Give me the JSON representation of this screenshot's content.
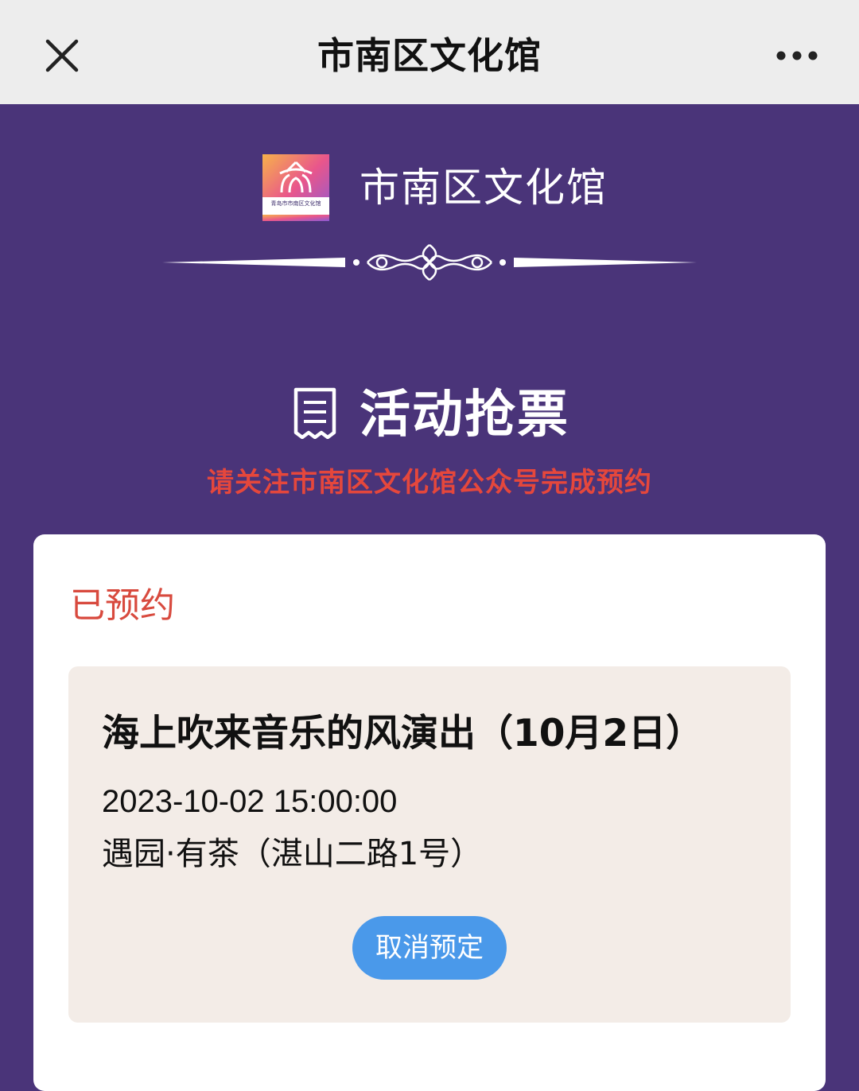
{
  "topbar": {
    "title": "市南区文化馆"
  },
  "brand": {
    "name": "市南区文化馆",
    "logo_text": "青岛市市南区文化馆"
  },
  "section": {
    "title": "活动抢票",
    "notice": "请关注市南区文化馆公众号完成预约"
  },
  "booking": {
    "status": "已预约",
    "event_title": "海上吹来音乐的风演出（10月2日）",
    "datetime": "2023-10-02 15:00:00",
    "location": "遇园·有茶（湛山二路1号）",
    "cancel_label": "取消预定"
  },
  "icons": {
    "close": "close-icon",
    "more": "more-icon",
    "ticket": "ticket-icon",
    "logo": "museum-logo-icon"
  },
  "colors": {
    "background": "#4a3479",
    "topbar": "#ededed",
    "notice": "#e5473c",
    "status": "#d84a3e",
    "event_box": "#f3ece7",
    "button": "#4a99ea"
  }
}
